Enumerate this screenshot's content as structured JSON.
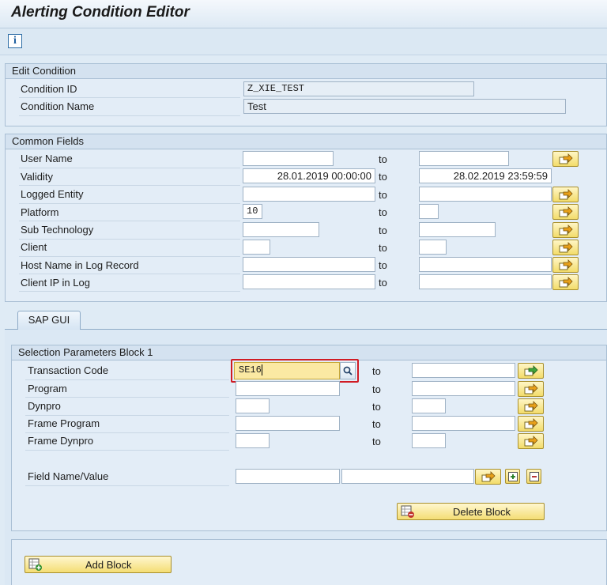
{
  "title": "Alerting Condition Editor",
  "toolbar": {
    "info_icon": "info-icon"
  },
  "edit_condition": {
    "title": "Edit Condition",
    "condition_id_label": "Condition ID",
    "condition_id_value": "Z_XIE_TEST",
    "condition_name_label": "Condition Name",
    "condition_name_value": "Test"
  },
  "common_fields": {
    "title": "Common Fields",
    "to_label": "to",
    "rows": [
      {
        "label": "User Name",
        "from": "",
        "to": ""
      },
      {
        "label": "Validity",
        "from": "28.01.2019 00:00:00",
        "to": "28.02.2019 23:59:59"
      },
      {
        "label": "Logged Entity",
        "from": "",
        "to": ""
      },
      {
        "label": "Platform",
        "from": "10",
        "to": ""
      },
      {
        "label": "Sub Technology",
        "from": "",
        "to": ""
      },
      {
        "label": "Client",
        "from": "",
        "to": ""
      },
      {
        "label": "Host Name in Log Record",
        "from": "",
        "to": ""
      },
      {
        "label": "Client IP in Log",
        "from": "",
        "to": ""
      }
    ]
  },
  "tabs": [
    {
      "label": "SAP GUI"
    }
  ],
  "block1": {
    "title": "Selection Parameters Block 1",
    "to_label": "to",
    "rows": [
      {
        "label": "Transaction Code",
        "from": "SE16",
        "to": ""
      },
      {
        "label": "Program",
        "from": "",
        "to": ""
      },
      {
        "label": "Dynpro",
        "from": "",
        "to": ""
      },
      {
        "label": "Frame Program",
        "from": "",
        "to": ""
      },
      {
        "label": "Frame Dynpro",
        "from": "",
        "to": ""
      }
    ],
    "field_name_label": "Field Name/Value",
    "field_name": "",
    "field_value": "",
    "delete_block_label": "Delete Block"
  },
  "add_block_label": "Add Block",
  "colors": {
    "highlight": "#d01b24",
    "button": "#f3dc6a",
    "background": "#dfebf5"
  }
}
